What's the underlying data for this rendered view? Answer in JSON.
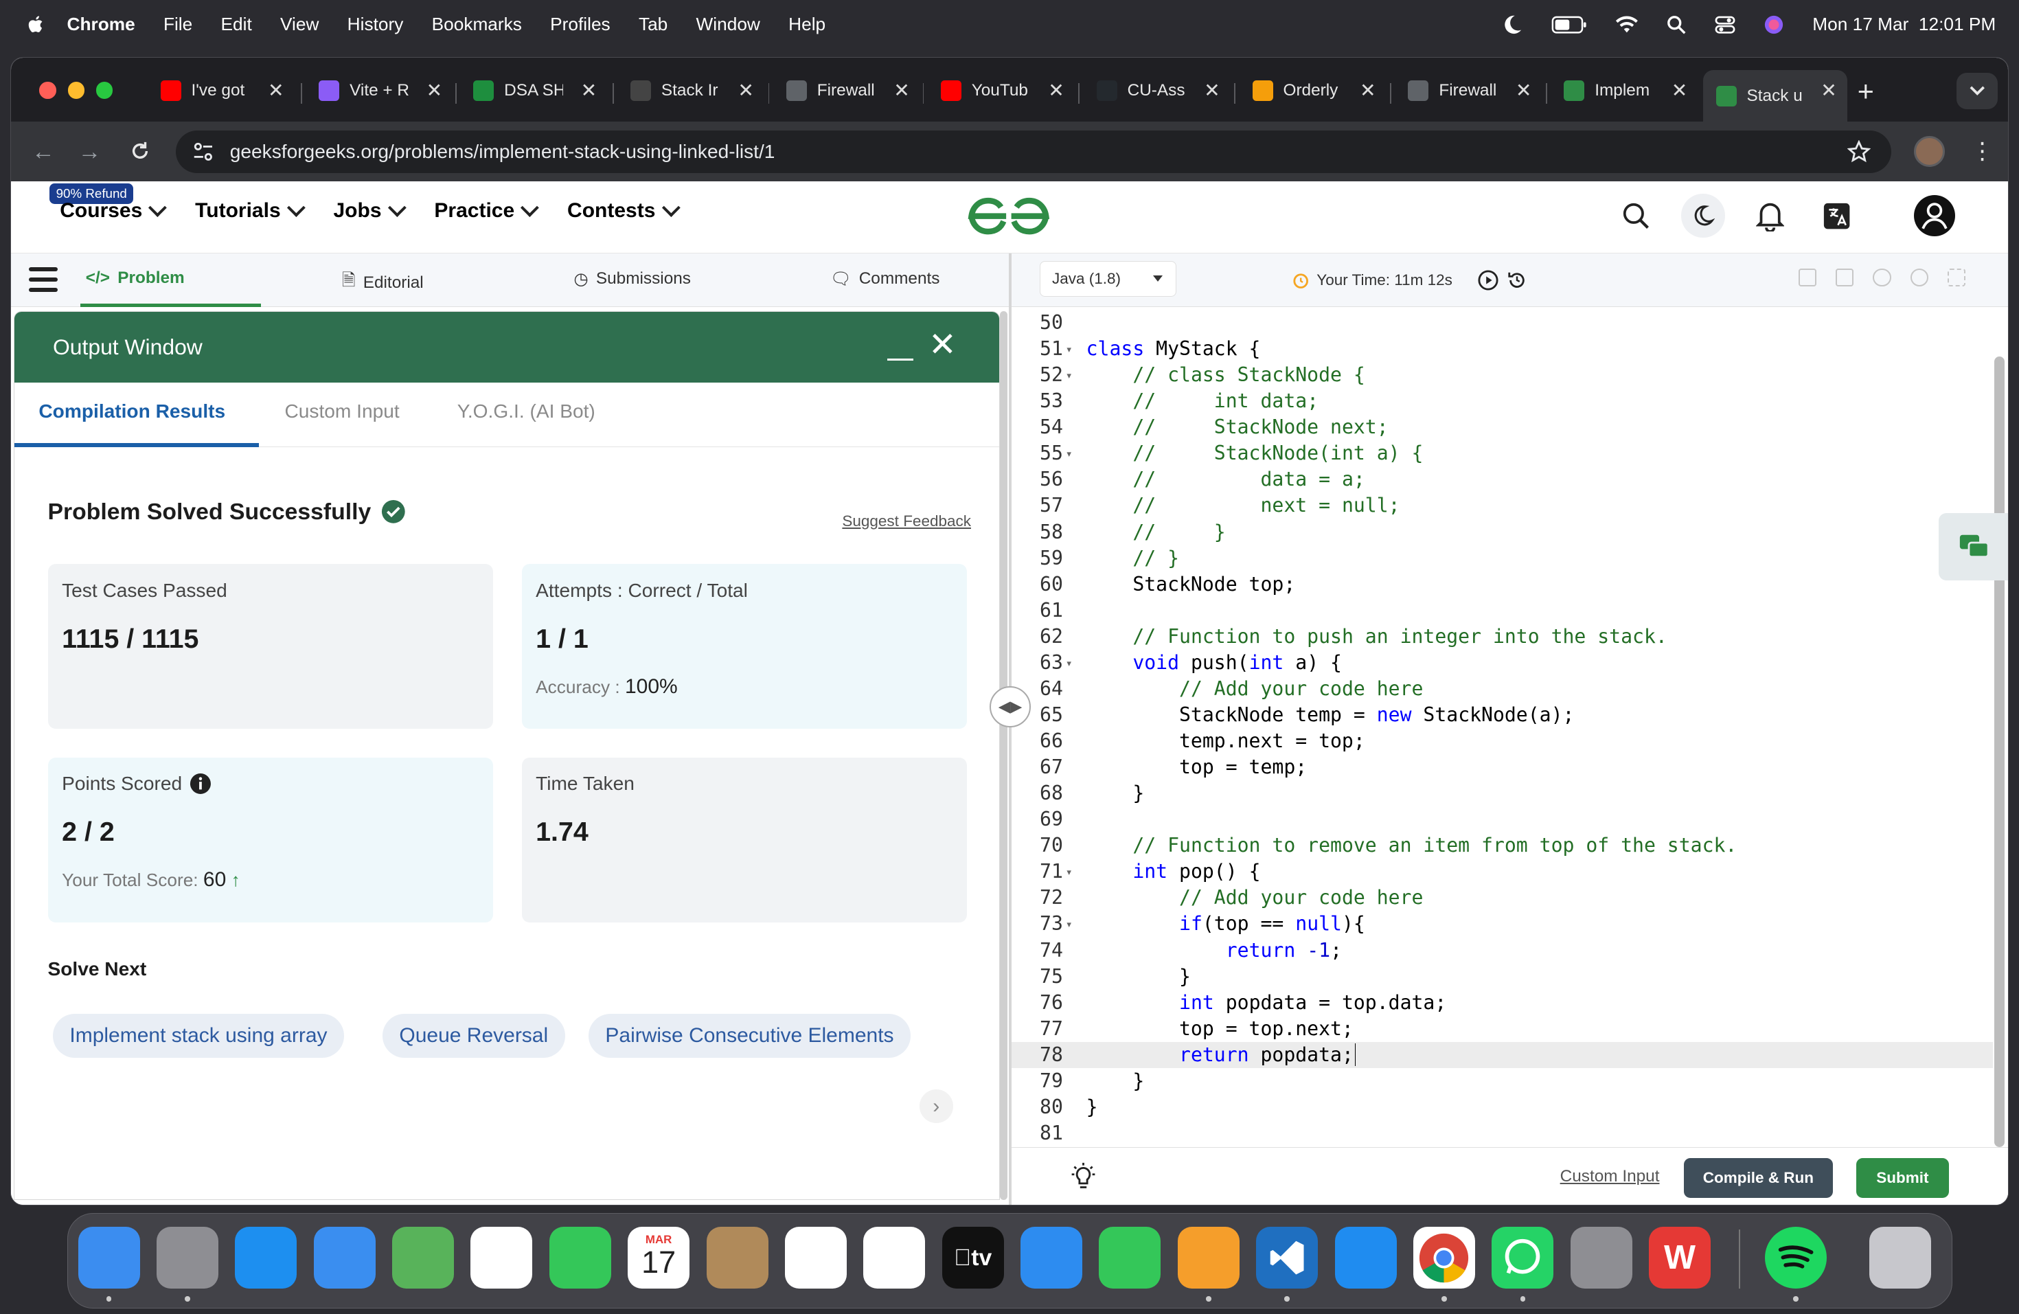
{
  "menubar": {
    "items": [
      "Chrome",
      "File",
      "Edit",
      "View",
      "History",
      "Bookmarks",
      "Profiles",
      "Tab",
      "Window",
      "Help"
    ],
    "datetime": "Mon 17 Mar  12:01 PM"
  },
  "browser": {
    "tabs": [
      {
        "label": "I've got",
        "icon": "youtube-icon",
        "color": "#ff0000"
      },
      {
        "label": "Vite + R",
        "icon": "vite-icon",
        "color": "#8b5cf6"
      },
      {
        "label": "DSA SH",
        "icon": "sheets-icon",
        "color": "#1e8e3e"
      },
      {
        "label": "Stack Ir",
        "icon": "openai-icon",
        "color": "#444444"
      },
      {
        "label": "Firewall",
        "icon": "globe-icon",
        "color": "#5f6368"
      },
      {
        "label": "YouTub",
        "icon": "youtube-icon",
        "color": "#ff0000"
      },
      {
        "label": "CU-Ass",
        "icon": "github-icon",
        "color": "#24292e"
      },
      {
        "label": "Orderly",
        "icon": "orderly-icon",
        "color": "#f59e0b"
      },
      {
        "label": "Firewall",
        "icon": "globe-icon",
        "color": "#5f6368"
      },
      {
        "label": "Implem",
        "icon": "gfg-icon",
        "color": "#2f8d46"
      },
      {
        "label": "Stack u",
        "icon": "gfg-icon",
        "color": "#2f8d46"
      }
    ],
    "url": "geeksforgeeks.org/problems/implement-stack-using-linked-list/1"
  },
  "site": {
    "refund_badge": "90% Refund",
    "nav": [
      "Courses",
      "Tutorials",
      "Jobs",
      "Practice",
      "Contests"
    ]
  },
  "problem_tabs": [
    "Problem",
    "Editorial",
    "Submissions",
    "Comments"
  ],
  "output": {
    "title": "Output Window",
    "tabs": [
      "Compilation Results",
      "Custom Input",
      "Y.O.G.I. (AI Bot)"
    ],
    "status": "Problem Solved Successfully",
    "feedback": "Suggest Feedback",
    "cards": {
      "tests_label": "Test Cases Passed",
      "tests_value": "1115 / 1115",
      "attempts_label": "Attempts : Correct / Total",
      "attempts_value": "1 / 1",
      "accuracy_label": "Accuracy :",
      "accuracy_value": "100%",
      "points_label": "Points Scored",
      "points_value": "2 / 2",
      "total_label": "Your Total Score:",
      "total_value": "60",
      "time_label": "Time Taken",
      "time_value": "1.74"
    },
    "solve_next": "Solve Next",
    "suggestions": [
      "Implement stack using array",
      "Queue Reversal",
      "Pairwise Consecutive Elements"
    ]
  },
  "editor": {
    "language": "Java (1.8)",
    "timer": "Your Time: 11m 12s",
    "lines": [
      {
        "n": "50",
        "fold": false,
        "code": ""
      },
      {
        "n": "51",
        "fold": true,
        "code": "class MyStack {"
      },
      {
        "n": "52",
        "fold": true,
        "code": "    // class StackNode {"
      },
      {
        "n": "53",
        "fold": false,
        "code": "    //     int data;"
      },
      {
        "n": "54",
        "fold": false,
        "code": "    //     StackNode next;"
      },
      {
        "n": "55",
        "fold": true,
        "code": "    //     StackNode(int a) {"
      },
      {
        "n": "56",
        "fold": false,
        "code": "    //         data = a;"
      },
      {
        "n": "57",
        "fold": false,
        "code": "    //         next = null;"
      },
      {
        "n": "58",
        "fold": false,
        "code": "    //     }"
      },
      {
        "n": "59",
        "fold": false,
        "code": "    // }"
      },
      {
        "n": "60",
        "fold": false,
        "code": "    StackNode top;"
      },
      {
        "n": "61",
        "fold": false,
        "code": ""
      },
      {
        "n": "62",
        "fold": false,
        "code": "    // Function to push an integer into the stack."
      },
      {
        "n": "63",
        "fold": true,
        "code": "    void push(int a) {"
      },
      {
        "n": "64",
        "fold": false,
        "code": "        // Add your code here"
      },
      {
        "n": "65",
        "fold": false,
        "code": "        StackNode temp = new StackNode(a);"
      },
      {
        "n": "66",
        "fold": false,
        "code": "        temp.next = top;"
      },
      {
        "n": "67",
        "fold": false,
        "code": "        top = temp;"
      },
      {
        "n": "68",
        "fold": false,
        "code": "    }"
      },
      {
        "n": "69",
        "fold": false,
        "code": ""
      },
      {
        "n": "70",
        "fold": false,
        "code": "    // Function to remove an item from top of the stack."
      },
      {
        "n": "71",
        "fold": true,
        "code": "    int pop() {"
      },
      {
        "n": "72",
        "fold": false,
        "code": "        // Add your code here"
      },
      {
        "n": "73",
        "fold": true,
        "code": "        if(top == null){"
      },
      {
        "n": "74",
        "fold": false,
        "code": "            return -1;"
      },
      {
        "n": "75",
        "fold": false,
        "code": "        }"
      },
      {
        "n": "76",
        "fold": false,
        "code": "        int popdata = top.data;"
      },
      {
        "n": "77",
        "fold": false,
        "code": "        top = top.next;"
      },
      {
        "n": "78",
        "fold": false,
        "code": "        return popdata;",
        "highlight": true
      },
      {
        "n": "79",
        "fold": false,
        "code": "    }"
      },
      {
        "n": "80",
        "fold": false,
        "code": "}"
      },
      {
        "n": "81",
        "fold": false,
        "code": ""
      }
    ],
    "custom_input": "Custom Input",
    "compile": "Compile & Run",
    "submit": "Submit"
  },
  "dock": {
    "calendar_month": "MAR",
    "calendar_day": "17",
    "tv_label": "tv",
    "apps": [
      {
        "name": "finder",
        "color": "#3b8df0"
      },
      {
        "name": "launchpad",
        "color": "#8e8e93"
      },
      {
        "name": "safari",
        "color": "#1d8ff0"
      },
      {
        "name": "mail",
        "color": "#3a8ef0"
      },
      {
        "name": "maps",
        "color": "#58b35a"
      },
      {
        "name": "photos",
        "color": "#ffffff"
      },
      {
        "name": "facetime",
        "color": "#34c759"
      },
      {
        "name": "calendar",
        "color": "#ffffff"
      },
      {
        "name": "contacts",
        "color": "#b08a5a"
      },
      {
        "name": "reminders",
        "color": "#ffffff"
      },
      {
        "name": "freeform",
        "color": "#ffffff"
      },
      {
        "name": "apple-tv",
        "color": "#111111"
      },
      {
        "name": "keynote",
        "color": "#2d8cf0"
      },
      {
        "name": "numbers",
        "color": "#34c759"
      },
      {
        "name": "pages",
        "color": "#f59e2b"
      },
      {
        "name": "vscode",
        "color": "#1f6fc0"
      },
      {
        "name": "app-store",
        "color": "#1f8cf0"
      },
      {
        "name": "chrome",
        "color": "#ffffff"
      },
      {
        "name": "whatsapp",
        "color": "#25d366"
      },
      {
        "name": "system-settings",
        "color": "#8e8e93"
      },
      {
        "name": "wps-office",
        "color": "#e53935"
      },
      {
        "name": "spotify",
        "color": "#111111"
      },
      {
        "name": "trash",
        "color": "#c7c7cc"
      }
    ]
  }
}
